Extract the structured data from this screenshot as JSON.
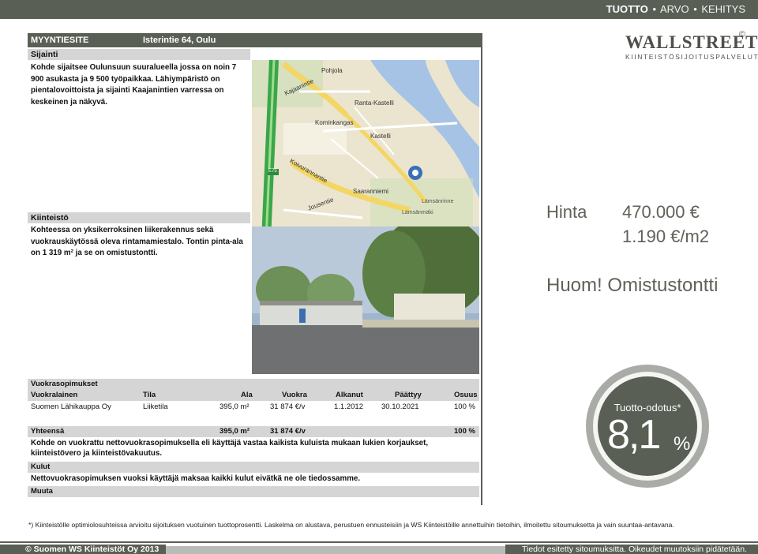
{
  "top_bar": {
    "item1": "TUOTTO",
    "sep": "•",
    "item2": "ARVO",
    "item3": "KEHITYS"
  },
  "logo": {
    "main": "WALLSTREET",
    "subtitle": "KIINTEISTÖSIJOITUSPALVELUT",
    "mark": "©"
  },
  "sheet": {
    "header_left": "MYYNTIESITE",
    "header_right": "Isterintie 64, Oulu",
    "location": {
      "heading": "Sijainti",
      "text": "Kohde sijaitsee Oulunsuun suuralueella jossa on noin 7 900 asukasta ja 9 500 työpaikkaa. Lähiympäristö on pientalovoittoista ja sijainti Kaajanintien varressa on keskeinen ja näkyvä."
    },
    "property": {
      "heading": "Kiinteistö",
      "text": "Kohteessa on yksikerroksinen liikerakennus sekä vuokrauskäytössä oleva rintamamiestalo. Tontin pinta-ala on 1 319 m² ja se on omistustontti."
    },
    "map_labels": [
      "Pohjola",
      "Kajaanintie",
      "Ranta-Kastelli",
      "Koivurannantie",
      "Kastelli",
      "Kominkangas",
      "Saaranniemi",
      "Lämsänrinne",
      "Lämsänmäki",
      "Jousentie",
      "E75",
      "4"
    ],
    "leases": {
      "heading": "Vuokrasopimukset",
      "columns": [
        "Vuokralainen",
        "Tila",
        "Ala",
        "Vuokra",
        "Alkanut",
        "Päättyy",
        "Osuus"
      ],
      "rows": [
        [
          "Suomen Lähikauppa Oy",
          "Liiketila",
          "395,0 m²",
          "31 874 €/v",
          "1.1.2012",
          "30.10.2021",
          "100 %"
        ]
      ],
      "total_label": "Yhteensä",
      "total_area": "395,0 m²",
      "total_rent": "31 874 €/v",
      "total_share": "100 %",
      "note": "Kohde on vuokrattu nettovuokrasopimuksella eli käyttäjä vastaa kaikista kuluista mukaan lukien korjaukset, kiinteistövero ja kiinteistövakuutus."
    },
    "costs": {
      "heading": "Kulut",
      "text": "Nettovuokrasopimuksen vuoksi käyttäjä maksaa kaikki kulut eivätkä ne ole tiedossamme."
    },
    "other": {
      "heading": "Muuta"
    }
  },
  "price": {
    "label": "Hinta",
    "value": "470.000 €",
    "per_m2": "1.190 €/m2"
  },
  "note": "Huom! Omistustontti",
  "yield": {
    "label": "Tuotto-odotus*",
    "value": "8,1",
    "unit": "%"
  },
  "footnote": "*) Kiinteistölle optimiolosuhteissa arvioitu sijoituksen vuotuinen tuottoprosentti. Laskelma on alustava, perustuen ennusteisiin ja WS Kiinteistöille annettuihin tietoihin, ilmoitettu sitoumuksetta ja vain suuntaa-antavana.",
  "footer": {
    "left": "© Suomen WS Kiinteistöt Oy 2013",
    "right": "Tiedot esitetty sitoumuksitta. Oikeudet muutoksiin pidätetään."
  }
}
